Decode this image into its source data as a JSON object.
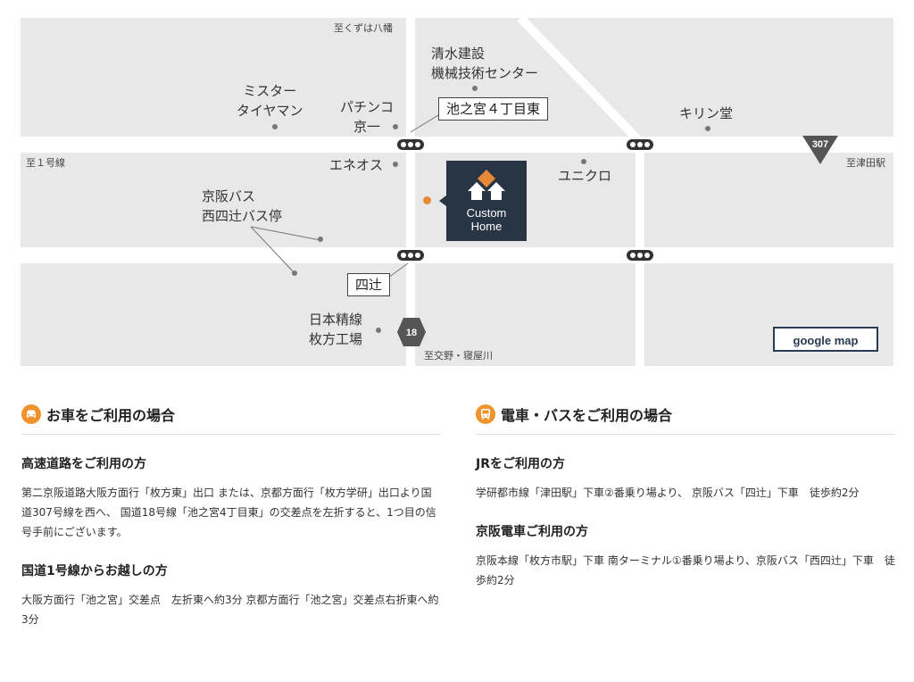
{
  "map": {
    "labels": {
      "top_dir": "至くずは八幡",
      "left_dir": "至１号線",
      "right_dir": "至津田駅",
      "bottom_dir": "至交野・寝屋川",
      "shimizu": "清水建設\n機械技術センター",
      "mister": "ミスター\nタイヤマン",
      "pachinko": "パチンコ\n京一",
      "kirin": "キリン堂",
      "eneos": "エネオス",
      "uniqlo": "ユニクロ",
      "keihan_bus": "京阪バス\n西四辻バス停",
      "nippon": "日本精線\n枚方工場"
    },
    "box_labels": {
      "ikenomiya": "池之宮４丁目東",
      "yotsutsuji": "四辻"
    },
    "route_signs": {
      "r307": "307",
      "r18": "18"
    },
    "store_label": "Custom\nHome",
    "google_map_button": "google map",
    "colors": {
      "bg": "#e8e8e8",
      "road": "#ffffff",
      "store": "#283545",
      "accent": "#e8893a"
    }
  },
  "access": {
    "car": {
      "title": "お車をご利用の場合",
      "icon": "car-icon",
      "sections": [
        {
          "heading": "高速道路をご利用の方",
          "text": "第二京阪道路大阪方面行「枚方東」出口 または、京都方面行「枚方学研」出口より国道307号線を西へ、 国道18号線「池之宮4丁目東」の交差点を左折すると、1つ目の信号手前にございます。"
        },
        {
          "heading": "国道1号線からお越しの方",
          "text": "大阪方面行「池之宮」交差点　左折東へ約3分 京都方面行「池之宮」交差点右折東へ約3分"
        }
      ]
    },
    "train": {
      "title": "電車・バスをご利用の場合",
      "icon": "train-icon",
      "sections": [
        {
          "heading": "JRをご利用の方",
          "text": "学研都市線「津田駅」下車②番乗り場より、 京阪バス「四辻」下車　徒歩約2分"
        },
        {
          "heading": "京阪電車ご利用の方",
          "text": "京阪本線「枚方市駅」下車 南ターミナル①番乗り場より、京阪バス「西四辻」下車　徒歩約2分"
        }
      ]
    }
  }
}
